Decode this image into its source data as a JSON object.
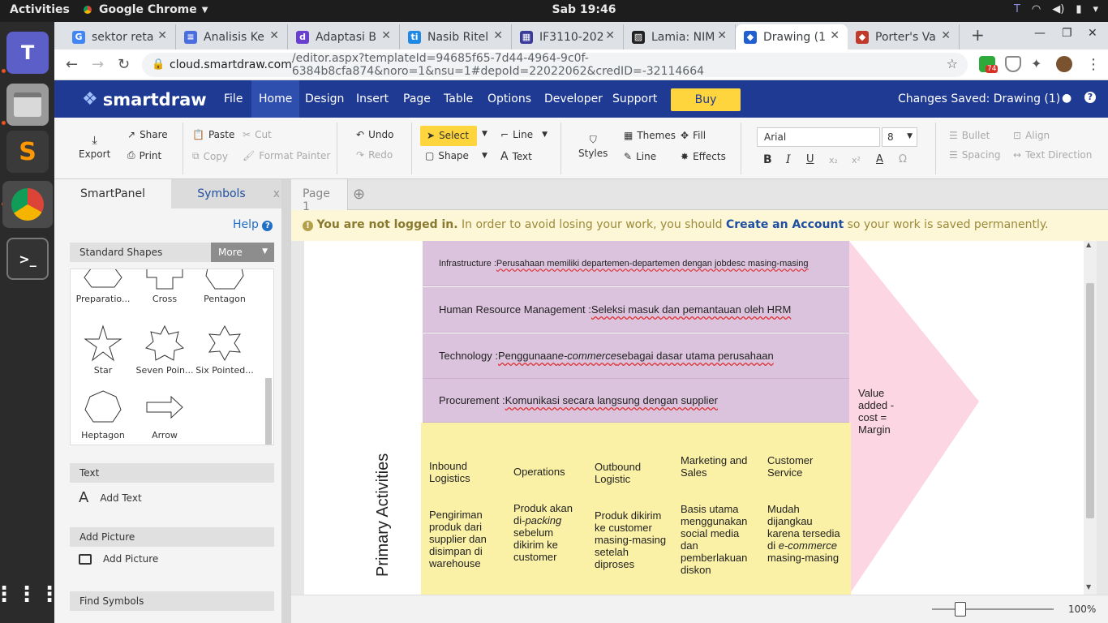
{
  "topbar": {
    "activities": "Activities",
    "app": "Google Chrome",
    "clock": "Sab 19:46"
  },
  "tabs": [
    {
      "title": "sektor reta",
      "fav": "G",
      "color": "#4285f4"
    },
    {
      "title": "Analisis Ke",
      "fav": "≡",
      "color": "#4a6ee0"
    },
    {
      "title": "Adaptasi B",
      "fav": "d",
      "color": "#6a3fd0"
    },
    {
      "title": "Nasib Ritel",
      "fav": "ti",
      "color": "#1e88e5"
    },
    {
      "title": "IF3110-202",
      "fav": "▦",
      "color": "#3a3a9a"
    },
    {
      "title": "Lamia: NIM",
      "fav": "▨",
      "color": "#222222"
    },
    {
      "title": "Drawing (1",
      "fav": "◆",
      "color": "#1f5fd0"
    },
    {
      "title": "Porter's Va",
      "fav": "◆",
      "color": "#c0392b"
    }
  ],
  "address": {
    "host": "cloud.smartdraw.com",
    "path": "/editor.aspx?templateId=94685f65-7d44-4964-9c0f-6384b8cfa874&noro=1&nsu=1#depoId=22022062&credID=-32114664",
    "badge": "74"
  },
  "header": {
    "logo": "smartdraw",
    "menus": [
      "File",
      "Home",
      "Design",
      "Insert",
      "Page",
      "Table",
      "Options",
      "Developer",
      "Support"
    ],
    "buy": "Buy",
    "saved": "Changes Saved: Drawing (1)"
  },
  "ribbon": {
    "export": "Export",
    "share": "Share",
    "print": "Print",
    "paste": "Paste",
    "cut": "Cut",
    "copy": "Copy",
    "format_painter": "Format Painter",
    "undo": "Undo",
    "redo": "Redo",
    "select": "Select",
    "shape": "Shape",
    "line": "Line",
    "text": "Text",
    "styles": "Styles",
    "themes": "Themes",
    "line2": "Line",
    "fill": "Fill",
    "effects": "Effects",
    "font": "Arial",
    "size": "8",
    "bullet": "Bullet",
    "align": "Align",
    "spacing": "Spacing",
    "text_direction": "Text Direction"
  },
  "panel": {
    "tab_smart": "SmartPanel",
    "tab_symbols": "Symbols",
    "help": "Help",
    "standard_shapes": "Standard Shapes",
    "more": "More",
    "shapes": [
      "Preparatio...",
      "Cross",
      "Pentagon",
      "Star",
      "Seven Poin...",
      "Six Pointed...",
      "Heptagon",
      "Arrow"
    ],
    "text_hdr": "Text",
    "add_text": "Add Text",
    "picture_hdr": "Add Picture",
    "add_picture": "Add Picture",
    "find_hdr": "Find Symbols"
  },
  "page": {
    "tab": "Page 1"
  },
  "notice": {
    "bold": "You are not logged in.",
    "text1": " In order to avoid losing your work, you should ",
    "link": "Create an Account",
    "text2": " so your work is saved permanently."
  },
  "diagram": {
    "support": [
      {
        "label": "Infrastructure : ",
        "value": "Perusahaan memiliki departemen-departemen dengan jobdesc masing-masing",
        "small": true
      },
      {
        "label": "Human Resource Management : ",
        "value": "Seleksi masuk dan pemantauan oleh HRM",
        "small": false
      },
      {
        "label": "Technology : ",
        "value_parts": [
          "Penggunaan ",
          "e-commerce",
          " sebagai dasar utama perusahaan"
        ],
        "small": false
      },
      {
        "label": "Procurement : ",
        "value": "Komunikasi secara langsung dengan supplier",
        "small": false
      }
    ],
    "primary_label": "Primary Activities",
    "margin": "Value added - cost = Margin",
    "primary": [
      {
        "title": "Inbound Logistics",
        "desc": "Pengiriman produk dari supplier dan disimpan di warehouse"
      },
      {
        "title": "Operations",
        "desc_parts": [
          "Produk akan di-",
          "packing",
          " sebelum dikirim ke customer"
        ]
      },
      {
        "title": "Outbound Logistic",
        "desc": "Produk dikirim ke customer masing-masing setelah diproses"
      },
      {
        "title": "Marketing and Sales",
        "desc": "Basis utama menggunakan social media dan pemberlakuan diskon"
      },
      {
        "title": "Customer Service",
        "desc_parts": [
          "Mudah dijangkau karena tersedia di ",
          "e-commerce",
          " masing-masing"
        ]
      }
    ]
  },
  "zoom": "100%"
}
